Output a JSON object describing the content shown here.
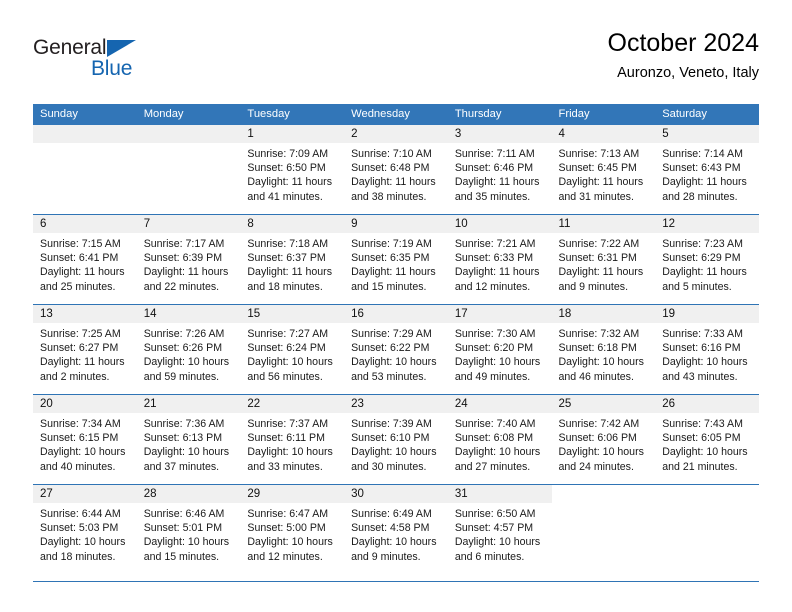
{
  "brand": {
    "name_part1": "General",
    "name_part2": "Blue",
    "accent_color": "#1565b0"
  },
  "header": {
    "title": "October 2024",
    "subtitle": "Auronzo, Veneto, Italy"
  },
  "theme": {
    "header_row_bg": "#3276b8",
    "row_divider": "#2f74b5",
    "daynum_bg": "#f0f0f0"
  },
  "weekdays": [
    "Sunday",
    "Monday",
    "Tuesday",
    "Wednesday",
    "Thursday",
    "Friday",
    "Saturday"
  ],
  "labels": {
    "sunrise_prefix": "Sunrise:",
    "sunset_prefix": "Sunset:",
    "daylight_prefix": "Daylight:"
  },
  "weeks": [
    [
      {
        "day": "",
        "empty": true
      },
      {
        "day": "",
        "empty": true
      },
      {
        "day": "1",
        "sunrise": "Sunrise: 7:09 AM",
        "sunset": "Sunset: 6:50 PM",
        "daylight_line1": "Daylight: 11 hours",
        "daylight_line2": "and 41 minutes."
      },
      {
        "day": "2",
        "sunrise": "Sunrise: 7:10 AM",
        "sunset": "Sunset: 6:48 PM",
        "daylight_line1": "Daylight: 11 hours",
        "daylight_line2": "and 38 minutes."
      },
      {
        "day": "3",
        "sunrise": "Sunrise: 7:11 AM",
        "sunset": "Sunset: 6:46 PM",
        "daylight_line1": "Daylight: 11 hours",
        "daylight_line2": "and 35 minutes."
      },
      {
        "day": "4",
        "sunrise": "Sunrise: 7:13 AM",
        "sunset": "Sunset: 6:45 PM",
        "daylight_line1": "Daylight: 11 hours",
        "daylight_line2": "and 31 minutes."
      },
      {
        "day": "5",
        "sunrise": "Sunrise: 7:14 AM",
        "sunset": "Sunset: 6:43 PM",
        "daylight_line1": "Daylight: 11 hours",
        "daylight_line2": "and 28 minutes."
      }
    ],
    [
      {
        "day": "6",
        "sunrise": "Sunrise: 7:15 AM",
        "sunset": "Sunset: 6:41 PM",
        "daylight_line1": "Daylight: 11 hours",
        "daylight_line2": "and 25 minutes."
      },
      {
        "day": "7",
        "sunrise": "Sunrise: 7:17 AM",
        "sunset": "Sunset: 6:39 PM",
        "daylight_line1": "Daylight: 11 hours",
        "daylight_line2": "and 22 minutes."
      },
      {
        "day": "8",
        "sunrise": "Sunrise: 7:18 AM",
        "sunset": "Sunset: 6:37 PM",
        "daylight_line1": "Daylight: 11 hours",
        "daylight_line2": "and 18 minutes."
      },
      {
        "day": "9",
        "sunrise": "Sunrise: 7:19 AM",
        "sunset": "Sunset: 6:35 PM",
        "daylight_line1": "Daylight: 11 hours",
        "daylight_line2": "and 15 minutes."
      },
      {
        "day": "10",
        "sunrise": "Sunrise: 7:21 AM",
        "sunset": "Sunset: 6:33 PM",
        "daylight_line1": "Daylight: 11 hours",
        "daylight_line2": "and 12 minutes."
      },
      {
        "day": "11",
        "sunrise": "Sunrise: 7:22 AM",
        "sunset": "Sunset: 6:31 PM",
        "daylight_line1": "Daylight: 11 hours",
        "daylight_line2": "and 9 minutes."
      },
      {
        "day": "12",
        "sunrise": "Sunrise: 7:23 AM",
        "sunset": "Sunset: 6:29 PM",
        "daylight_line1": "Daylight: 11 hours",
        "daylight_line2": "and 5 minutes."
      }
    ],
    [
      {
        "day": "13",
        "sunrise": "Sunrise: 7:25 AM",
        "sunset": "Sunset: 6:27 PM",
        "daylight_line1": "Daylight: 11 hours",
        "daylight_line2": "and 2 minutes."
      },
      {
        "day": "14",
        "sunrise": "Sunrise: 7:26 AM",
        "sunset": "Sunset: 6:26 PM",
        "daylight_line1": "Daylight: 10 hours",
        "daylight_line2": "and 59 minutes."
      },
      {
        "day": "15",
        "sunrise": "Sunrise: 7:27 AM",
        "sunset": "Sunset: 6:24 PM",
        "daylight_line1": "Daylight: 10 hours",
        "daylight_line2": "and 56 minutes."
      },
      {
        "day": "16",
        "sunrise": "Sunrise: 7:29 AM",
        "sunset": "Sunset: 6:22 PM",
        "daylight_line1": "Daylight: 10 hours",
        "daylight_line2": "and 53 minutes."
      },
      {
        "day": "17",
        "sunrise": "Sunrise: 7:30 AM",
        "sunset": "Sunset: 6:20 PM",
        "daylight_line1": "Daylight: 10 hours",
        "daylight_line2": "and 49 minutes."
      },
      {
        "day": "18",
        "sunrise": "Sunrise: 7:32 AM",
        "sunset": "Sunset: 6:18 PM",
        "daylight_line1": "Daylight: 10 hours",
        "daylight_line2": "and 46 minutes."
      },
      {
        "day": "19",
        "sunrise": "Sunrise: 7:33 AM",
        "sunset": "Sunset: 6:16 PM",
        "daylight_line1": "Daylight: 10 hours",
        "daylight_line2": "and 43 minutes."
      }
    ],
    [
      {
        "day": "20",
        "sunrise": "Sunrise: 7:34 AM",
        "sunset": "Sunset: 6:15 PM",
        "daylight_line1": "Daylight: 10 hours",
        "daylight_line2": "and 40 minutes."
      },
      {
        "day": "21",
        "sunrise": "Sunrise: 7:36 AM",
        "sunset": "Sunset: 6:13 PM",
        "daylight_line1": "Daylight: 10 hours",
        "daylight_line2": "and 37 minutes."
      },
      {
        "day": "22",
        "sunrise": "Sunrise: 7:37 AM",
        "sunset": "Sunset: 6:11 PM",
        "daylight_line1": "Daylight: 10 hours",
        "daylight_line2": "and 33 minutes."
      },
      {
        "day": "23",
        "sunrise": "Sunrise: 7:39 AM",
        "sunset": "Sunset: 6:10 PM",
        "daylight_line1": "Daylight: 10 hours",
        "daylight_line2": "and 30 minutes."
      },
      {
        "day": "24",
        "sunrise": "Sunrise: 7:40 AM",
        "sunset": "Sunset: 6:08 PM",
        "daylight_line1": "Daylight: 10 hours",
        "daylight_line2": "and 27 minutes."
      },
      {
        "day": "25",
        "sunrise": "Sunrise: 7:42 AM",
        "sunset": "Sunset: 6:06 PM",
        "daylight_line1": "Daylight: 10 hours",
        "daylight_line2": "and 24 minutes."
      },
      {
        "day": "26",
        "sunrise": "Sunrise: 7:43 AM",
        "sunset": "Sunset: 6:05 PM",
        "daylight_line1": "Daylight: 10 hours",
        "daylight_line2": "and 21 minutes."
      }
    ],
    [
      {
        "day": "27",
        "sunrise": "Sunrise: 6:44 AM",
        "sunset": "Sunset: 5:03 PM",
        "daylight_line1": "Daylight: 10 hours",
        "daylight_line2": "and 18 minutes."
      },
      {
        "day": "28",
        "sunrise": "Sunrise: 6:46 AM",
        "sunset": "Sunset: 5:01 PM",
        "daylight_line1": "Daylight: 10 hours",
        "daylight_line2": "and 15 minutes."
      },
      {
        "day": "29",
        "sunrise": "Sunrise: 6:47 AM",
        "sunset": "Sunset: 5:00 PM",
        "daylight_line1": "Daylight: 10 hours",
        "daylight_line2": "and 12 minutes."
      },
      {
        "day": "30",
        "sunrise": "Sunrise: 6:49 AM",
        "sunset": "Sunset: 4:58 PM",
        "daylight_line1": "Daylight: 10 hours",
        "daylight_line2": "and 9 minutes."
      },
      {
        "day": "31",
        "sunrise": "Sunrise: 6:50 AM",
        "sunset": "Sunset: 4:57 PM",
        "daylight_line1": "Daylight: 10 hours",
        "daylight_line2": "and 6 minutes."
      },
      {
        "day": "",
        "blank": true
      },
      {
        "day": "",
        "blank": true
      }
    ]
  ]
}
